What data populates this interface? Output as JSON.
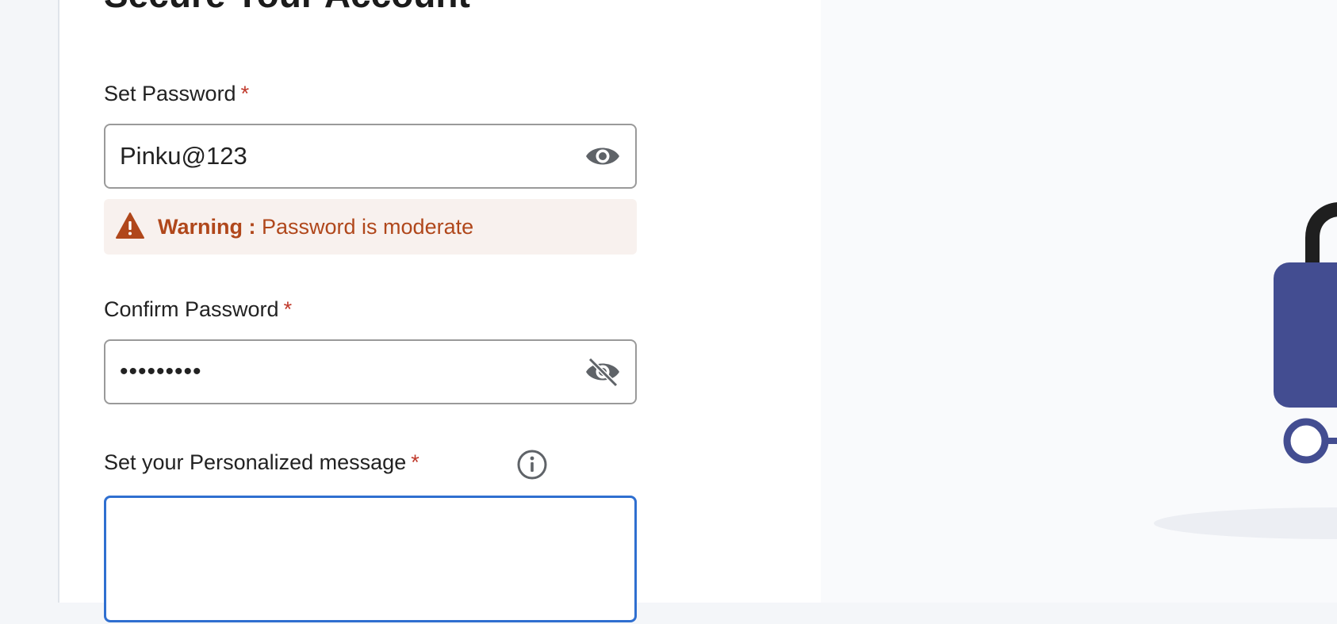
{
  "page": {
    "title": "Secure Your Account"
  },
  "password": {
    "label": "Set Password",
    "required_mark": "*",
    "value": "Pinku@123",
    "visibility_icon": "eye-icon"
  },
  "warning": {
    "label": "Warning :",
    "message": "Password is moderate",
    "icon": "warning-triangle-icon",
    "color": "#b0471b",
    "background": "#f8f1ee"
  },
  "confirm_password": {
    "label": "Confirm Password",
    "required_mark": "*",
    "value": "Pinku@123",
    "visibility_icon": "eye-off-icon"
  },
  "personalized_message": {
    "label": "Set your Personalized message",
    "required_mark": "*",
    "value": "",
    "info_icon": "info-icon"
  },
  "colors": {
    "required": "#c0392b",
    "focus_border": "#2f6fd0",
    "lock_body": "#434d91",
    "lock_shackle": "#1f1f1f"
  }
}
